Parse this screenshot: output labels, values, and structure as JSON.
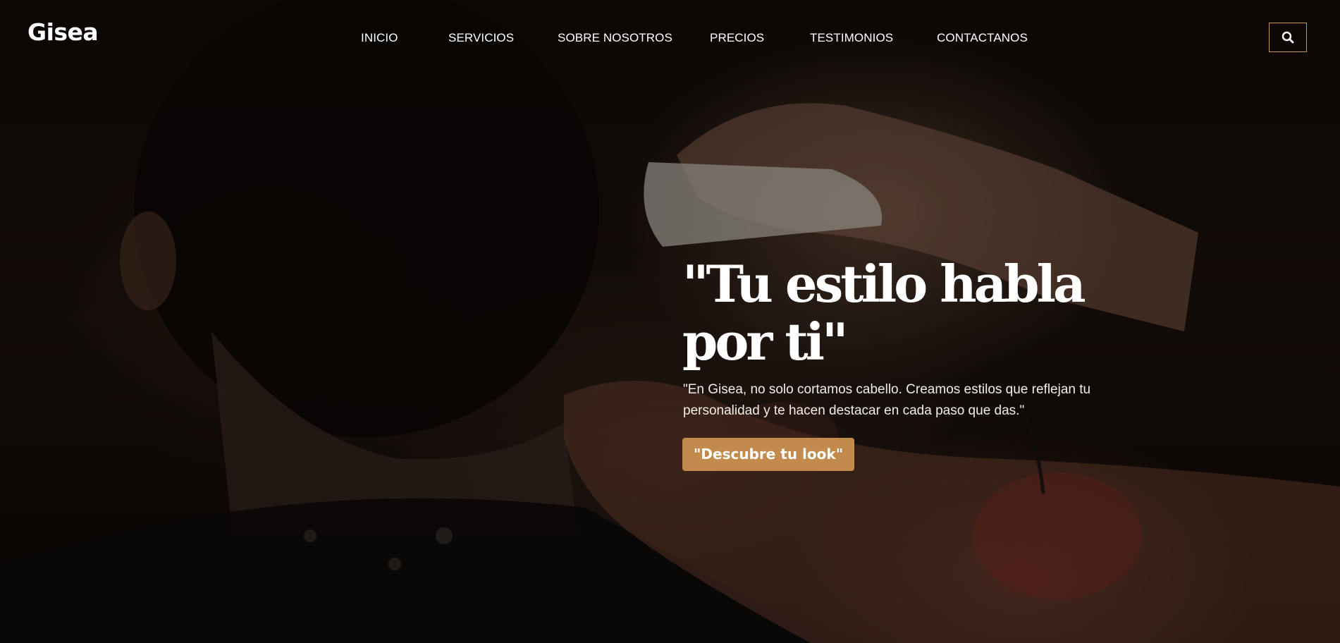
{
  "brand": {
    "name": "Gisea"
  },
  "nav": {
    "items": [
      {
        "label": "INICIO"
      },
      {
        "label": "SERVICIOS"
      },
      {
        "label": "SOBRE NOSOTROS"
      },
      {
        "label": "PRECIOS"
      },
      {
        "label": "TESTIMONIOS"
      },
      {
        "label": "CONTACTANOS"
      }
    ]
  },
  "search": {
    "icon": "search-icon"
  },
  "hero": {
    "title": "\"Tu estilo habla por ti\"",
    "subtitle": "\"En Gisea, no solo cortamos cabello. Creamos estilos que reflejan tu personalidad y te hacen destacar en cada paso que das.\"",
    "cta_label": "\"Descubre tu look\""
  },
  "colors": {
    "accent": "#c28a4b",
    "search_border": "#c7925c",
    "text": "#ffffff"
  }
}
